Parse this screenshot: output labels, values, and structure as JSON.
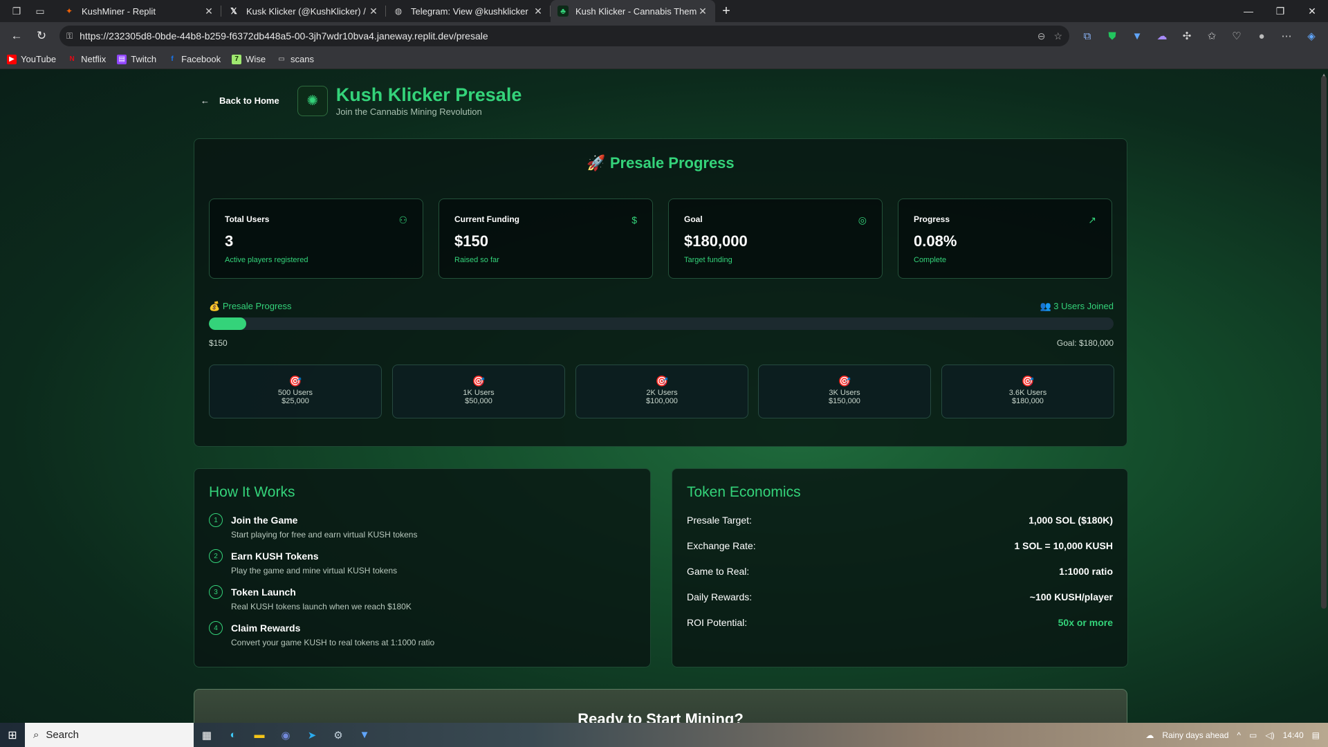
{
  "browser": {
    "tabs": [
      {
        "title": "KushMiner - Replit",
        "favicon": "replit-icon",
        "active": false
      },
      {
        "title": "Kusk Klicker (@KushKlicker) / X",
        "favicon": "x-icon",
        "active": false
      },
      {
        "title": "Telegram: View @kushklicker",
        "favicon": "globe-icon",
        "active": false
      },
      {
        "title": "Kush Klicker - Cannabis Themed C",
        "favicon": "leaf-icon",
        "active": true
      }
    ],
    "url": "https://232305d8-0bde-44b8-b259-f6372db448a5-00-3jh7wdr10bva4.janeway.replit.dev/presale",
    "bookmarks": [
      {
        "label": "YouTube",
        "icon": "youtube-icon",
        "color": "#ff0000"
      },
      {
        "label": "Netflix",
        "icon": "netflix-icon",
        "color": "#e50914"
      },
      {
        "label": "Twitch",
        "icon": "twitch-icon",
        "color": "#9146ff"
      },
      {
        "label": "Facebook",
        "icon": "facebook-icon",
        "color": "#1877f2"
      },
      {
        "label": "Wise",
        "icon": "wise-icon",
        "color": "#9fe870"
      },
      {
        "label": "scans",
        "icon": "folder-icon",
        "color": "#cfcfcf"
      }
    ]
  },
  "header": {
    "back_label": "Back to Home",
    "title": "Kush Klicker Presale",
    "subtitle": "Join the Cannabis Mining Revolution"
  },
  "presale": {
    "title": "Presale Progress",
    "stats": [
      {
        "label": "Total Users",
        "value": "3",
        "note": "Active players registered",
        "icon": "users-icon"
      },
      {
        "label": "Current Funding",
        "value": "$150",
        "note": "Raised so far",
        "icon": "dollar-icon"
      },
      {
        "label": "Goal",
        "value": "$180,000",
        "note": "Target funding",
        "icon": "target-icon"
      },
      {
        "label": "Progress",
        "value": "0.08%",
        "note": "Complete",
        "icon": "trending-up-icon"
      }
    ],
    "progress_label": "Presale Progress",
    "users_joined": "3 Users Joined",
    "progress_fraction": 0.0008,
    "raised_label": "$150",
    "goal_label": "Goal: $180,000",
    "milestones": [
      {
        "users": "500 Users",
        "amount": "$25,000"
      },
      {
        "users": "1K Users",
        "amount": "$50,000"
      },
      {
        "users": "2K Users",
        "amount": "$100,000"
      },
      {
        "users": "3K Users",
        "amount": "$150,000"
      },
      {
        "users": "3.6K Users",
        "amount": "$180,000"
      }
    ]
  },
  "how_it_works": {
    "title": "How It Works",
    "steps": [
      {
        "num": "1",
        "title": "Join the Game",
        "desc": "Start playing for free and earn virtual KUSH tokens"
      },
      {
        "num": "2",
        "title": "Earn KUSH Tokens",
        "desc": "Play the game and mine virtual KUSH tokens"
      },
      {
        "num": "3",
        "title": "Token Launch",
        "desc": "Real KUSH tokens launch when we reach $180K"
      },
      {
        "num": "4",
        "title": "Claim Rewards",
        "desc": "Convert your game KUSH to real tokens at 1:1000 ratio"
      }
    ]
  },
  "token_economics": {
    "title": "Token Economics",
    "rows": [
      {
        "key": "Presale Target:",
        "value": "1,000 SOL ($180K)"
      },
      {
        "key": "Exchange Rate:",
        "value": "1 SOL = 10,000 KUSH"
      },
      {
        "key": "Game to Real:",
        "value": "1:1000 ratio"
      },
      {
        "key": "Daily Rewards:",
        "value": "~100 KUSH/player"
      },
      {
        "key": "ROI Potential:",
        "value": "50x or more"
      }
    ]
  },
  "cta": {
    "title": "Ready to Start Mining?"
  },
  "taskbar": {
    "search_label": "Search",
    "weather": "Rainy days ahead",
    "time": "14:40"
  },
  "colors": {
    "accent": "#34d37a",
    "milestone_icon": "#ff4d4d"
  }
}
